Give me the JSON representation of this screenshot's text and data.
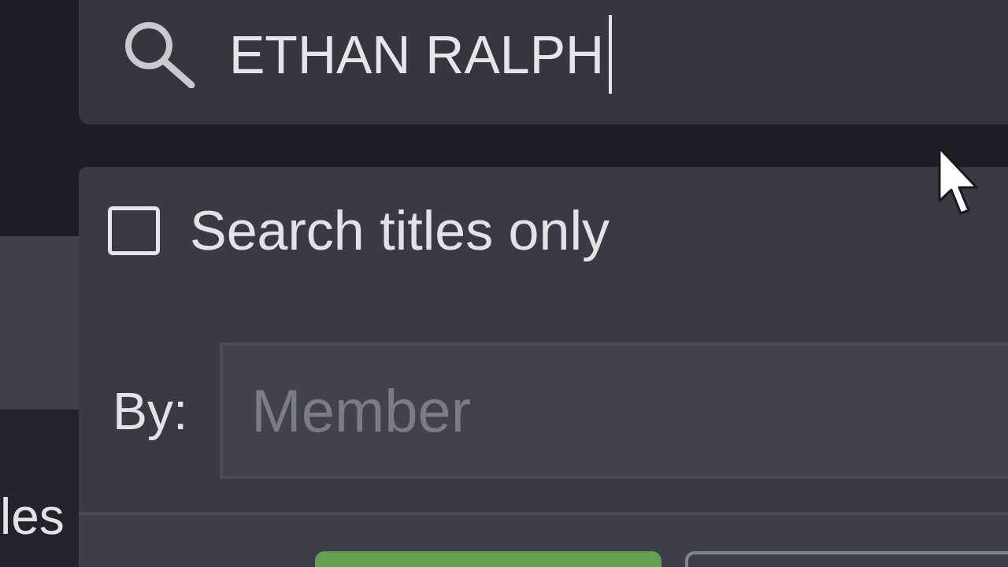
{
  "search": {
    "value": "ETHAN RALPH",
    "focused": true
  },
  "options": [
    {
      "kind": "checkbox",
      "label": "Search titles only",
      "checked": false
    }
  ],
  "by": {
    "label": "By:",
    "placeholder": "Member"
  },
  "side_text": "les",
  "footer": {
    "buttons": [
      {
        "kind": "primary"
      },
      {
        "kind": "secondary"
      }
    ]
  }
}
